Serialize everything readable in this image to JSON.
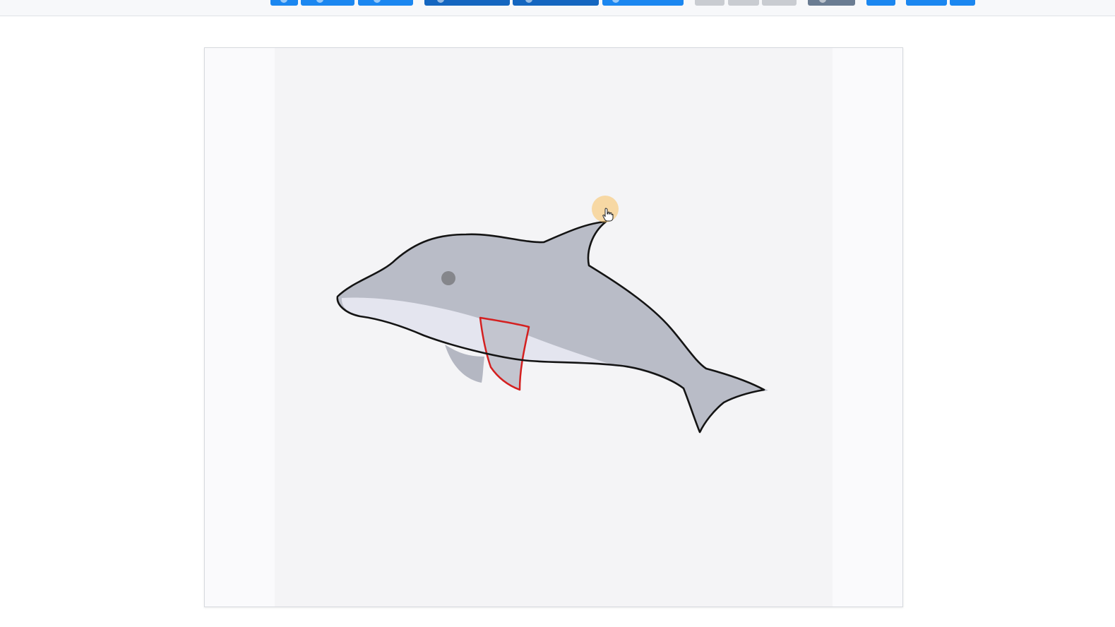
{
  "toolbar": {
    "label": "",
    "buttons": [
      {
        "name": "toolbar-button-1",
        "color": "#1b87f0"
      },
      {
        "name": "toolbar-button-2",
        "color": "#1b87f0"
      },
      {
        "name": "toolbar-button-3",
        "color": "#1b87f0"
      },
      {
        "name": "toolbar-button-4",
        "color": "#1466c0"
      },
      {
        "name": "toolbar-button-5",
        "color": "#1466c0"
      },
      {
        "name": "toolbar-button-6",
        "color": "#1b87f0"
      },
      {
        "name": "toolbar-button-7",
        "color": "#c9ccd1"
      },
      {
        "name": "toolbar-button-8",
        "color": "#c9ccd1"
      },
      {
        "name": "toolbar-button-9",
        "color": "#c9ccd1"
      },
      {
        "name": "toolbar-button-10",
        "color": "#6a7c92"
      },
      {
        "name": "toolbar-button-11",
        "color": "#1b87f0"
      },
      {
        "name": "toolbar-button-12",
        "color": "#1b87f0"
      },
      {
        "name": "toolbar-button-13",
        "color": "#1b87f0"
      }
    ]
  },
  "canvas": {
    "subject": "dolphin",
    "colors": {
      "body": "#b9bcc7",
      "belly": "#e4e5ef",
      "outline": "#141414",
      "fin_selection": "#d42020",
      "eye": "#85868b",
      "cursor_halo": "#f8c46e"
    }
  },
  "cursor": {
    "icon": "hand-pointer-icon"
  }
}
